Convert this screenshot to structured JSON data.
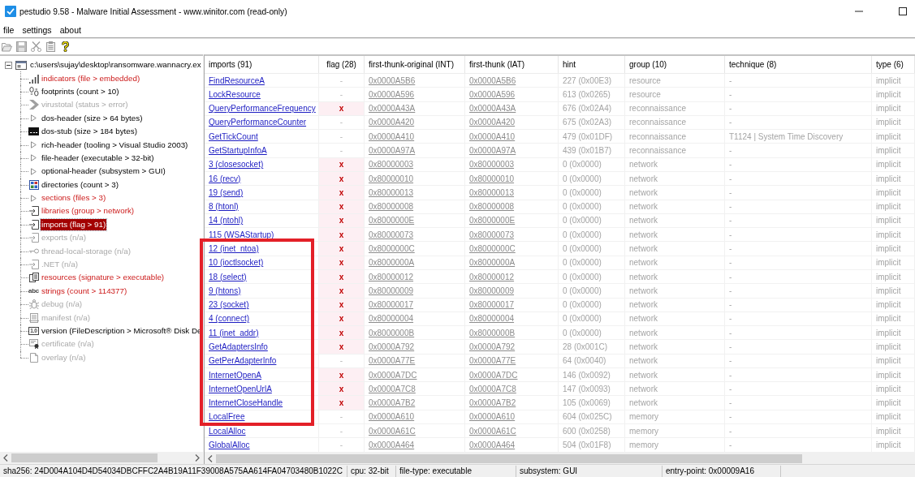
{
  "window": {
    "title": "pestudio 9.58 - Malware Initial Assessment - www.winitor.com (read-only)"
  },
  "menu": [
    "file",
    "settings",
    "about"
  ],
  "toolbar": [
    {
      "kind": "open",
      "disabled": true
    },
    {
      "kind": "save",
      "disabled": true
    },
    {
      "kind": "cut",
      "disabled": true
    },
    {
      "kind": "clipboard",
      "disabled": true
    },
    {
      "kind": "help",
      "disabled": false
    }
  ],
  "tree": {
    "label": "c:\\users\\sujay\\desktop\\ransomware.wannacry.ex",
    "expanded": true,
    "children": [
      {
        "kind": "indicators",
        "label": "indicators (file > embedded)",
        "flagged": true,
        "disabled": false,
        "selected": false
      },
      {
        "kind": "footprints",
        "label": "footprints (count > 10)",
        "flagged": false,
        "disabled": false,
        "selected": false
      },
      {
        "kind": "virustotal",
        "label": "virustotal (status > error)",
        "flagged": false,
        "disabled": true,
        "selected": false
      },
      {
        "kind": "header",
        "label": "dos-header (size > 64 bytes)",
        "flagged": false,
        "disabled": false,
        "selected": false
      },
      {
        "kind": "console",
        "label": "dos-stub (size > 184 bytes)",
        "flagged": false,
        "disabled": false,
        "selected": false
      },
      {
        "kind": "header",
        "label": "rich-header (tooling > Visual Studio 2003)",
        "flagged": false,
        "disabled": false,
        "selected": false
      },
      {
        "kind": "header",
        "label": "file-header (executable > 32-bit)",
        "flagged": false,
        "disabled": false,
        "selected": false
      },
      {
        "kind": "header",
        "label": "optional-header (subsystem > GUI)",
        "flagged": false,
        "disabled": false,
        "selected": false
      },
      {
        "kind": "directories",
        "label": "directories (count > 3)",
        "flagged": false,
        "disabled": false,
        "selected": false
      },
      {
        "kind": "header",
        "label": "sections (files > 3)",
        "flagged": true,
        "disabled": false,
        "selected": false
      },
      {
        "kind": "library",
        "label": "libraries (group > network)",
        "flagged": true,
        "disabled": false,
        "selected": false
      },
      {
        "kind": "library",
        "label": "imports (flag > 91)",
        "flagged": true,
        "disabled": false,
        "selected": true
      },
      {
        "kind": "library",
        "label": "exports (n/a)",
        "flagged": false,
        "disabled": true,
        "selected": false
      },
      {
        "kind": "key",
        "label": "thread-local-storage (n/a)",
        "flagged": false,
        "disabled": true,
        "selected": false
      },
      {
        "kind": "library",
        "label": ".NET (n/a)",
        "flagged": false,
        "disabled": true,
        "selected": false
      },
      {
        "kind": "resources",
        "label": "resources (signature > executable)",
        "flagged": true,
        "disabled": false,
        "selected": false
      },
      {
        "kind": "strings",
        "glyph": "abc",
        "label": "strings (count > 114377)",
        "flagged": true,
        "disabled": false,
        "selected": false
      },
      {
        "kind": "debug",
        "label": "debug (n/a)",
        "flagged": false,
        "disabled": true,
        "selected": false
      },
      {
        "kind": "manifest",
        "label": "manifest (n/a)",
        "flagged": false,
        "disabled": true,
        "selected": false
      },
      {
        "kind": "version",
        "glyph": "1.0",
        "label": "version (FileDescription > Microsoft® Disk De",
        "flagged": false,
        "disabled": false,
        "selected": false
      },
      {
        "kind": "certificate",
        "label": "certificate (n/a)",
        "flagged": false,
        "disabled": true,
        "selected": false
      },
      {
        "kind": "overlay",
        "label": "overlay (n/a)",
        "flagged": false,
        "disabled": true,
        "selected": false
      }
    ]
  },
  "table": {
    "columns": [
      "imports (91)",
      "flag (28)",
      "first-thunk-original (INT)",
      "first-thunk (IAT)",
      "hint",
      "group (10)",
      "technique (8)",
      "type (6)"
    ],
    "rows": [
      {
        "name": "FindResourceA",
        "flag": "-",
        "flagged": false,
        "int": "0x0000A5B6",
        "iat": "0x0000A5B6",
        "hint": "227 (0x00E3)",
        "group": "resource",
        "technique": "-",
        "type": "implicit"
      },
      {
        "name": "LockResource",
        "flag": "-",
        "flagged": false,
        "int": "0x0000A596",
        "iat": "0x0000A596",
        "hint": "613 (0x0265)",
        "group": "resource",
        "technique": "-",
        "type": "implicit"
      },
      {
        "name": "QueryPerformanceFrequency",
        "flag": "x",
        "flagged": true,
        "int": "0x0000A43A",
        "iat": "0x0000A43A",
        "hint": "676 (0x02A4)",
        "group": "reconnaissance",
        "technique": "-",
        "type": "implicit"
      },
      {
        "name": "QueryPerformanceCounter",
        "flag": "-",
        "flagged": false,
        "int": "0x0000A420",
        "iat": "0x0000A420",
        "hint": "675 (0x02A3)",
        "group": "reconnaissance",
        "technique": "-",
        "type": "implicit"
      },
      {
        "name": "GetTickCount",
        "flag": "-",
        "flagged": false,
        "int": "0x0000A410",
        "iat": "0x0000A410",
        "hint": "479 (0x01DF)",
        "group": "reconnaissance",
        "technique": "T1124 | System Time Discovery",
        "type": "implicit"
      },
      {
        "name": "GetStartupInfoA",
        "flag": "-",
        "flagged": false,
        "int": "0x0000A97A",
        "iat": "0x0000A97A",
        "hint": "439 (0x01B7)",
        "group": "reconnaissance",
        "technique": "-",
        "type": "implicit"
      },
      {
        "name": "3 (closesocket)",
        "flag": "x",
        "flagged": true,
        "int": "0x80000003",
        "iat": "0x80000003",
        "hint": "0 (0x0000)",
        "group": "network",
        "technique": "-",
        "type": "implicit"
      },
      {
        "name": "16 (recv)",
        "flag": "x",
        "flagged": true,
        "int": "0x80000010",
        "iat": "0x80000010",
        "hint": "0 (0x0000)",
        "group": "network",
        "technique": "-",
        "type": "implicit"
      },
      {
        "name": "19 (send)",
        "flag": "x",
        "flagged": true,
        "int": "0x80000013",
        "iat": "0x80000013",
        "hint": "0 (0x0000)",
        "group": "network",
        "technique": "-",
        "type": "implicit"
      },
      {
        "name": "8 (htonl)",
        "flag": "x",
        "flagged": true,
        "int": "0x80000008",
        "iat": "0x80000008",
        "hint": "0 (0x0000)",
        "group": "network",
        "technique": "-",
        "type": "implicit"
      },
      {
        "name": "14 (ntohl)",
        "flag": "x",
        "flagged": true,
        "int": "0x8000000E",
        "iat": "0x8000000E",
        "hint": "0 (0x0000)",
        "group": "network",
        "technique": "-",
        "type": "implicit"
      },
      {
        "name": "115 (WSAStartup)",
        "flag": "x",
        "flagged": true,
        "int": "0x80000073",
        "iat": "0x80000073",
        "hint": "0 (0x0000)",
        "group": "network",
        "technique": "-",
        "type": "implicit"
      },
      {
        "name": "12 (inet_ntoa)",
        "flag": "x",
        "flagged": true,
        "int": "0x8000000C",
        "iat": "0x8000000C",
        "hint": "0 (0x0000)",
        "group": "network",
        "technique": "-",
        "type": "implicit"
      },
      {
        "name": "10 (ioctlsocket)",
        "flag": "x",
        "flagged": true,
        "int": "0x8000000A",
        "iat": "0x8000000A",
        "hint": "0 (0x0000)",
        "group": "network",
        "technique": "-",
        "type": "implicit"
      },
      {
        "name": "18 (select)",
        "flag": "x",
        "flagged": true,
        "int": "0x80000012",
        "iat": "0x80000012",
        "hint": "0 (0x0000)",
        "group": "network",
        "technique": "-",
        "type": "implicit"
      },
      {
        "name": "9 (htons)",
        "flag": "x",
        "flagged": true,
        "int": "0x80000009",
        "iat": "0x80000009",
        "hint": "0 (0x0000)",
        "group": "network",
        "technique": "-",
        "type": "implicit"
      },
      {
        "name": "23 (socket)",
        "flag": "x",
        "flagged": true,
        "int": "0x80000017",
        "iat": "0x80000017",
        "hint": "0 (0x0000)",
        "group": "network",
        "technique": "-",
        "type": "implicit"
      },
      {
        "name": "4 (connect)",
        "flag": "x",
        "flagged": true,
        "int": "0x80000004",
        "iat": "0x80000004",
        "hint": "0 (0x0000)",
        "group": "network",
        "technique": "-",
        "type": "implicit"
      },
      {
        "name": "11 (inet_addr)",
        "flag": "x",
        "flagged": true,
        "int": "0x8000000B",
        "iat": "0x8000000B",
        "hint": "0 (0x0000)",
        "group": "network",
        "technique": "-",
        "type": "implicit"
      },
      {
        "name": "GetAdaptersInfo",
        "flag": "x",
        "flagged": true,
        "int": "0x0000A792",
        "iat": "0x0000A792",
        "hint": "28 (0x001C)",
        "group": "network",
        "technique": "-",
        "type": "implicit"
      },
      {
        "name": "GetPerAdapterInfo",
        "flag": "-",
        "flagged": false,
        "int": "0x0000A77E",
        "iat": "0x0000A77E",
        "hint": "64 (0x0040)",
        "group": "network",
        "technique": "-",
        "type": "implicit"
      },
      {
        "name": "InternetOpenA",
        "flag": "x",
        "flagged": true,
        "int": "0x0000A7DC",
        "iat": "0x0000A7DC",
        "hint": "146 (0x0092)",
        "group": "network",
        "technique": "-",
        "type": "implicit"
      },
      {
        "name": "InternetOpenUrlA",
        "flag": "x",
        "flagged": true,
        "int": "0x0000A7C8",
        "iat": "0x0000A7C8",
        "hint": "147 (0x0093)",
        "group": "network",
        "technique": "-",
        "type": "implicit"
      },
      {
        "name": "InternetCloseHandle",
        "flag": "x",
        "flagged": true,
        "int": "0x0000A7B2",
        "iat": "0x0000A7B2",
        "hint": "105 (0x0069)",
        "group": "network",
        "technique": "-",
        "type": "implicit"
      },
      {
        "name": "LocalFree",
        "flag": "-",
        "flagged": false,
        "int": "0x0000A610",
        "iat": "0x0000A610",
        "hint": "604 (0x025C)",
        "group": "memory",
        "technique": "-",
        "type": "implicit"
      },
      {
        "name": "LocalAlloc",
        "flag": "-",
        "flagged": false,
        "int": "0x0000A61C",
        "iat": "0x0000A61C",
        "hint": "600 (0x0258)",
        "group": "memory",
        "technique": "-",
        "type": "implicit"
      },
      {
        "name": "GlobalAlloc",
        "flag": "-",
        "flagged": false,
        "int": "0x0000A464",
        "iat": "0x0000A464",
        "hint": "504 (0x01F8)",
        "group": "memory",
        "technique": "-",
        "type": "implicit"
      }
    ]
  },
  "annotation": {
    "kind": "rectangle"
  },
  "status_bar": [
    "sha256: 24D004A104D4D54034DBCFFC2A4B19A11F39008A575AA614FA04703480B1022C",
    "cpu: 32-bit",
    "file-type: executable",
    "subsystem: GUI",
    "entry-point: 0x00009A16"
  ]
}
